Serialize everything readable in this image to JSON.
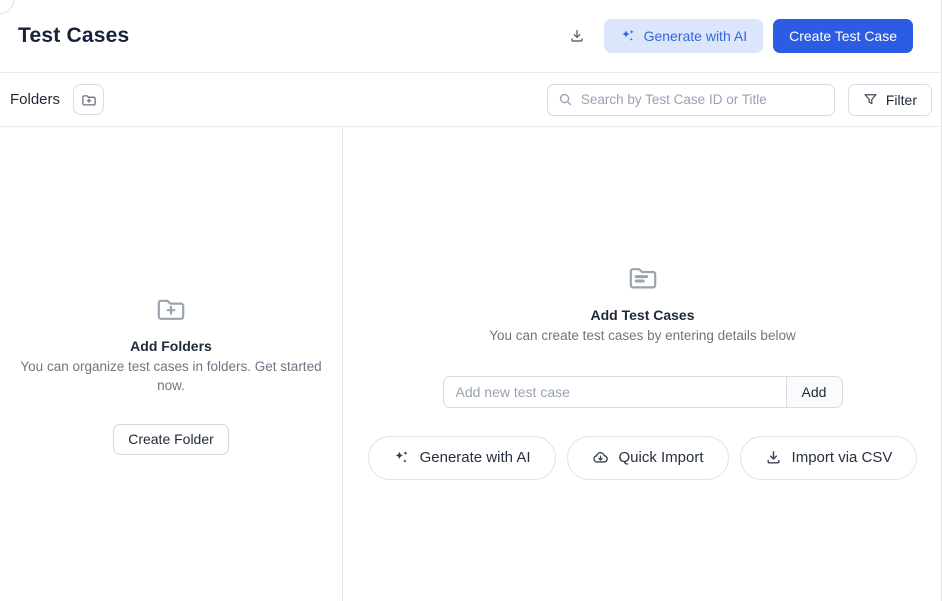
{
  "header": {
    "title": "Test Cases",
    "generate_ai_label": "Generate with AI",
    "create_test_case_label": "Create Test Case"
  },
  "toolbar": {
    "folders_label": "Folders",
    "search_placeholder": "Search by Test Case ID or Title",
    "filter_label": "Filter"
  },
  "left_panel": {
    "title": "Add Folders",
    "description": "You can organize test cases in folders. Get started now.",
    "create_folder_label": "Create Folder"
  },
  "right_panel": {
    "title": "Add Test Cases",
    "description": "You can create test cases by entering details below",
    "input_placeholder": "Add new test case",
    "add_button_label": "Add",
    "actions": [
      {
        "label": "Generate with AI",
        "icon": "sparkles-icon"
      },
      {
        "label": "Quick Import",
        "icon": "cloud-import-icon"
      },
      {
        "label": "Import via CSV",
        "icon": "download-icon"
      }
    ]
  },
  "colors": {
    "primary_blue": "#2b5ce3",
    "ai_button_bg": "#dce6fa",
    "ai_button_text": "#3566dd",
    "divider": "#e9ebee",
    "muted_text": "#6e7683",
    "icon_gray": "#9aa3af"
  }
}
